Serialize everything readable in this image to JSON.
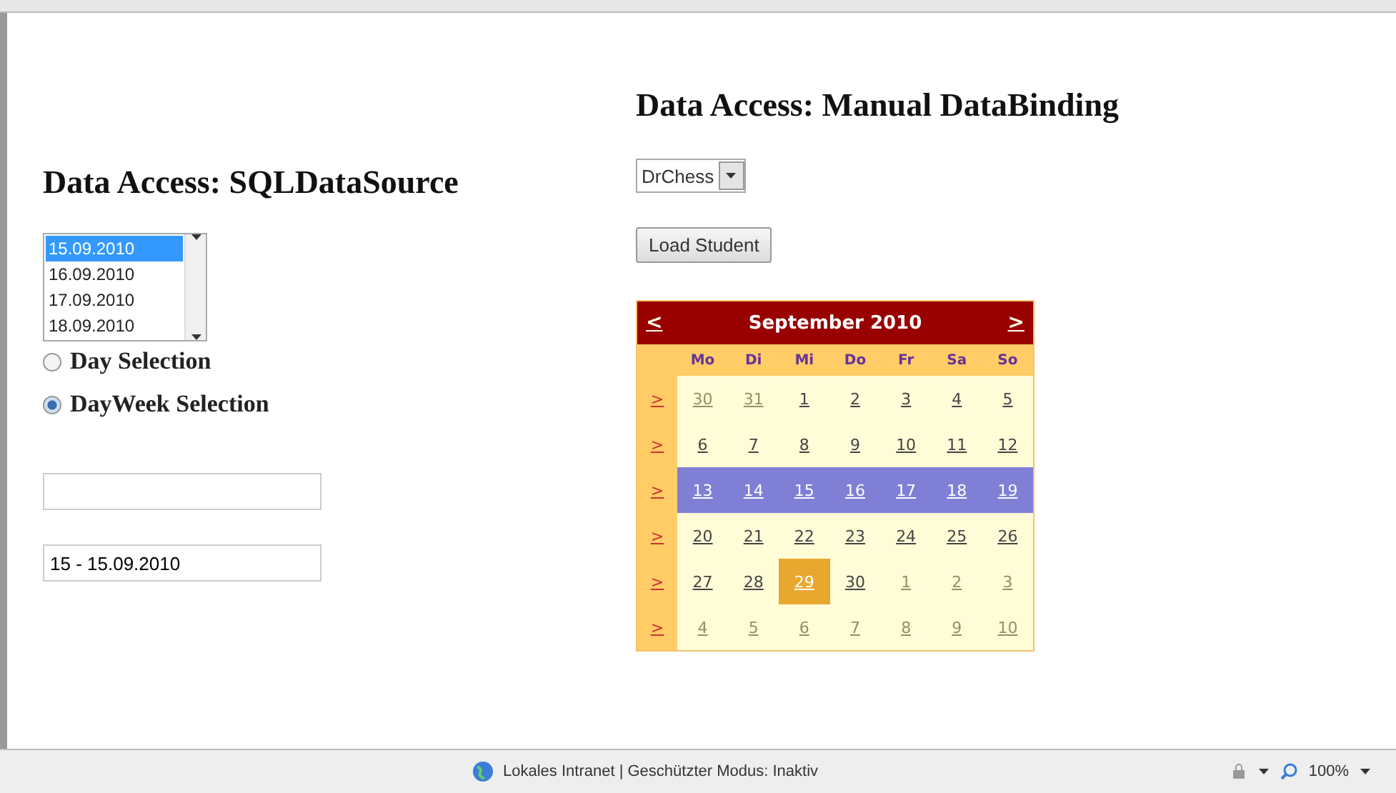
{
  "left": {
    "title": "Data Access: SQLDataSource",
    "dates": [
      {
        "label": "15.09.2010",
        "selected": true
      },
      {
        "label": "16.09.2010",
        "selected": false
      },
      {
        "label": "17.09.2010",
        "selected": false
      },
      {
        "label": "18.09.2010",
        "selected": false
      }
    ],
    "radios": [
      {
        "label": "Day Selection",
        "selected": false
      },
      {
        "label": "DayWeek Selection",
        "selected": true
      }
    ],
    "field_2": {
      "value": "15 - 15.09.2010"
    }
  },
  "right": {
    "title": "Data Access: Manual DataBinding",
    "dropdown": {
      "value": "DrChess"
    },
    "button": "Load Student",
    "calendar": {
      "prev": "<",
      "next": ">",
      "month": "September 2010",
      "weekdays": [
        "Mo",
        "Di",
        "Mi",
        "Do",
        "Fr",
        "Sa",
        "So"
      ],
      "weeks": [
        {
          "selector": ">",
          "selected": false,
          "days": [
            {
              "label": "30",
              "other": true,
              "today": false
            },
            {
              "label": "31",
              "other": true,
              "today": false
            },
            {
              "label": "1",
              "other": false,
              "today": false
            },
            {
              "label": "2",
              "other": false,
              "today": false
            },
            {
              "label": "3",
              "other": false,
              "today": false
            },
            {
              "label": "4",
              "other": false,
              "today": false
            },
            {
              "label": "5",
              "other": false,
              "today": false
            }
          ]
        },
        {
          "selector": ">",
          "selected": false,
          "days": [
            {
              "label": "6",
              "other": false,
              "today": false
            },
            {
              "label": "7",
              "other": false,
              "today": false
            },
            {
              "label": "8",
              "other": false,
              "today": false
            },
            {
              "label": "9",
              "other": false,
              "today": false
            },
            {
              "label": "10",
              "other": false,
              "today": false
            },
            {
              "label": "11",
              "other": false,
              "today": false
            },
            {
              "label": "12",
              "other": false,
              "today": false
            }
          ]
        },
        {
          "selector": ">",
          "selected": true,
          "days": [
            {
              "label": "13",
              "other": false,
              "today": false
            },
            {
              "label": "14",
              "other": false,
              "today": false
            },
            {
              "label": "15",
              "other": false,
              "today": false
            },
            {
              "label": "16",
              "other": false,
              "today": false
            },
            {
              "label": "17",
              "other": false,
              "today": false
            },
            {
              "label": "18",
              "other": false,
              "today": false
            },
            {
              "label": "19",
              "other": false,
              "today": false
            }
          ]
        },
        {
          "selector": ">",
          "selected": false,
          "days": [
            {
              "label": "20",
              "other": false,
              "today": false
            },
            {
              "label": "21",
              "other": false,
              "today": false
            },
            {
              "label": "22",
              "other": false,
              "today": false
            },
            {
              "label": "23",
              "other": false,
              "today": false
            },
            {
              "label": "24",
              "other": false,
              "today": false
            },
            {
              "label": "25",
              "other": false,
              "today": false
            },
            {
              "label": "26",
              "other": false,
              "today": false
            }
          ]
        },
        {
          "selector": ">",
          "selected": false,
          "days": [
            {
              "label": "27",
              "other": false,
              "today": false
            },
            {
              "label": "28",
              "other": false,
              "today": false
            },
            {
              "label": "29",
              "other": false,
              "today": true
            },
            {
              "label": "30",
              "other": false,
              "today": false
            },
            {
              "label": "1",
              "other": true,
              "today": false
            },
            {
              "label": "2",
              "other": true,
              "today": false
            },
            {
              "label": "3",
              "other": true,
              "today": false
            }
          ]
        },
        {
          "selector": ">",
          "selected": false,
          "days": [
            {
              "label": "4",
              "other": true,
              "today": false
            },
            {
              "label": "5",
              "other": true,
              "today": false
            },
            {
              "label": "6",
              "other": true,
              "today": false
            },
            {
              "label": "7",
              "other": true,
              "today": false
            },
            {
              "label": "8",
              "other": true,
              "today": false
            },
            {
              "label": "9",
              "other": true,
              "today": false
            },
            {
              "label": "10",
              "other": true,
              "today": false
            }
          ]
        }
      ]
    }
  },
  "status_bar": {
    "zone": "Lokales Intranet | Geschützter Modus: Inaktiv",
    "zoom": "100%"
  }
}
